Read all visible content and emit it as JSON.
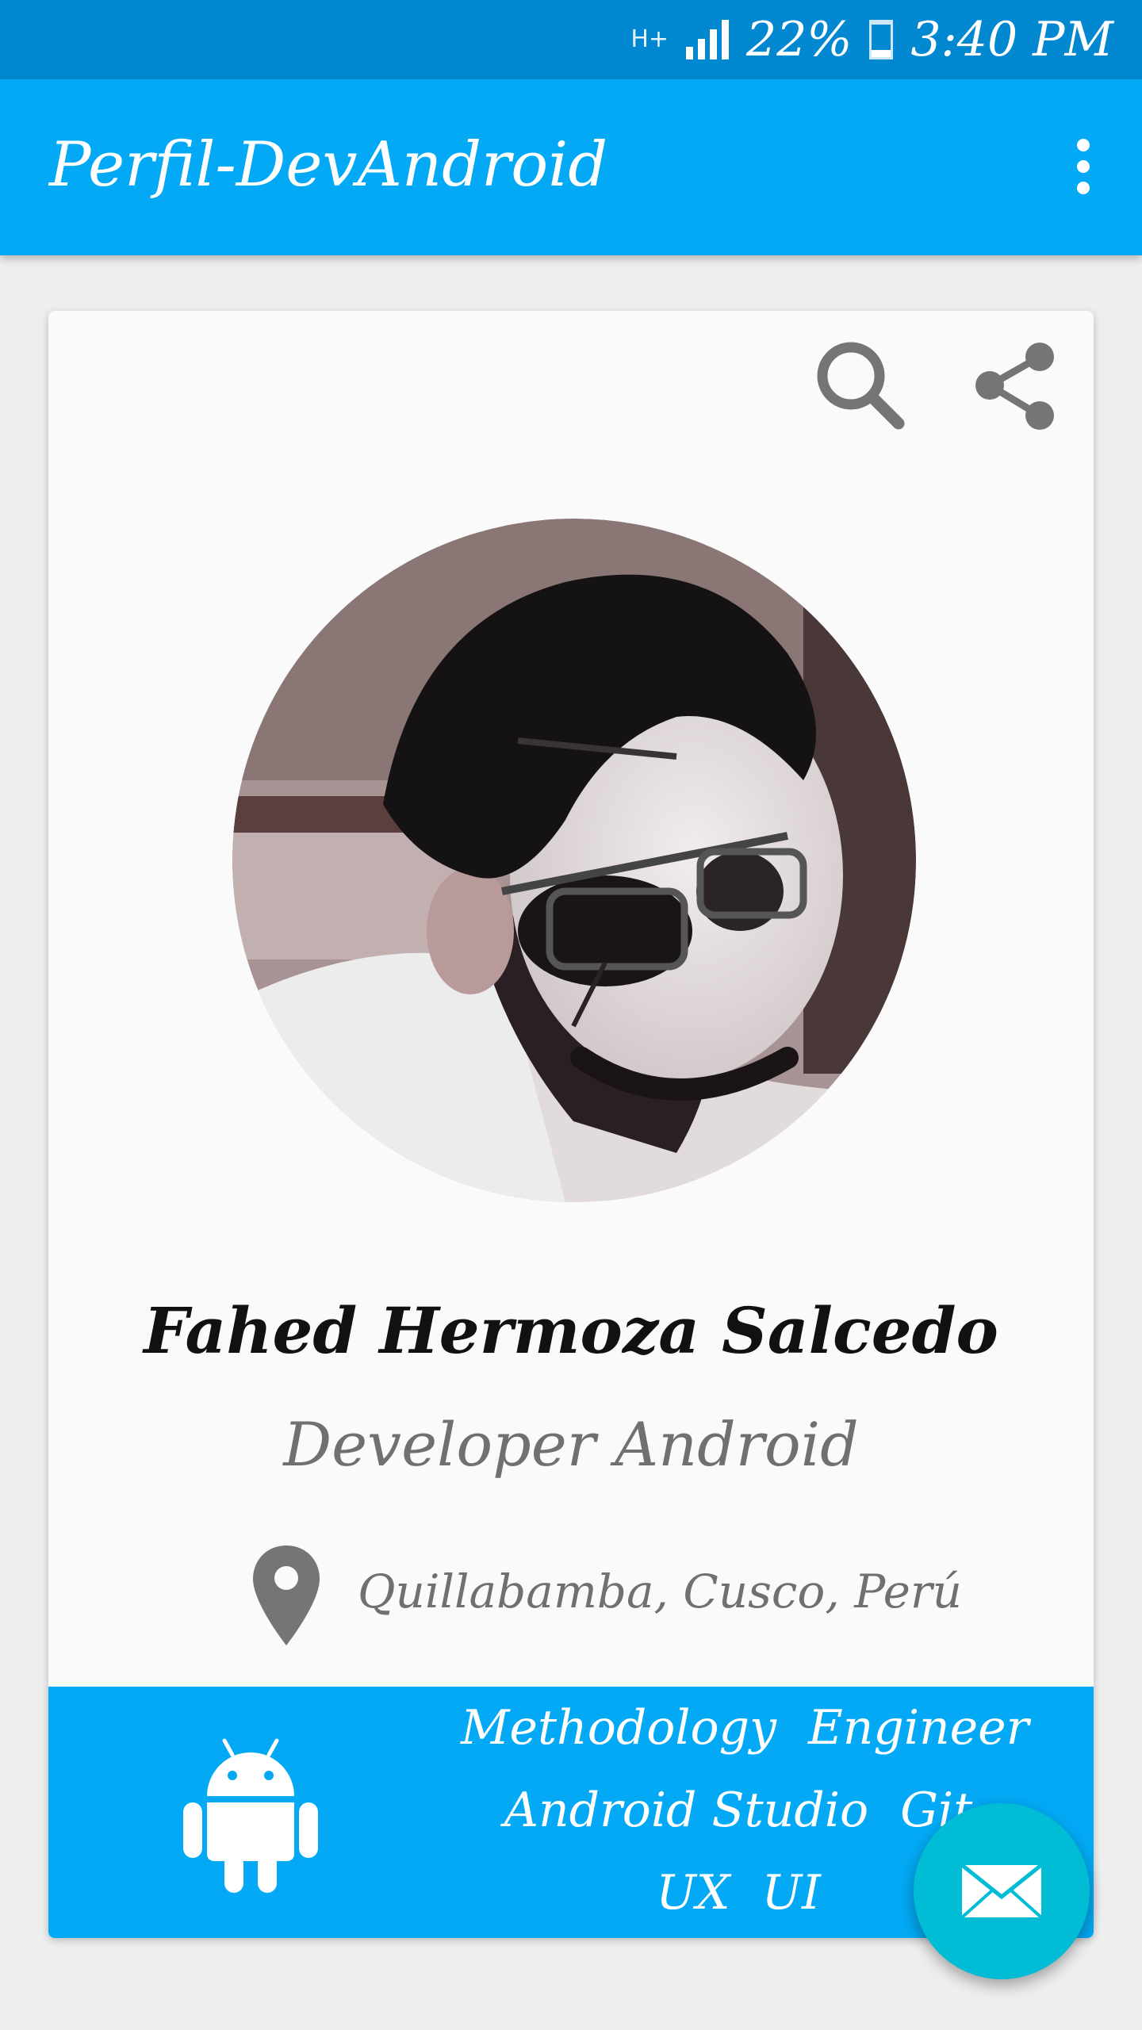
{
  "status_bar": {
    "network": "H+",
    "battery_percent_text": "22%",
    "battery_level": 0.22,
    "time": "3:40 PM"
  },
  "app_bar": {
    "title": "Perfil-DevAndroid",
    "menu_icon": "overflow-menu-icon"
  },
  "card": {
    "actions": {
      "search_icon": "search-icon",
      "share_icon": "share-icon"
    },
    "profile": {
      "name": "Fahed Hermoza Salcedo",
      "role": "Developer Android",
      "location": "Quillabamba, Cusco, Perú",
      "location_icon": "location-pin-icon"
    },
    "skills_panel": {
      "icon": "android-icon",
      "lines": [
        [
          "Methodology",
          "Engineer"
        ],
        [
          "Android Studio",
          "Git"
        ],
        [
          "UX",
          "UI"
        ]
      ]
    }
  },
  "fab": {
    "icon": "mail-icon"
  },
  "colors": {
    "status_bar": "#0288d1",
    "primary": "#03a9f4",
    "fab": "#00bcd4",
    "icon_gray": "#757575"
  }
}
